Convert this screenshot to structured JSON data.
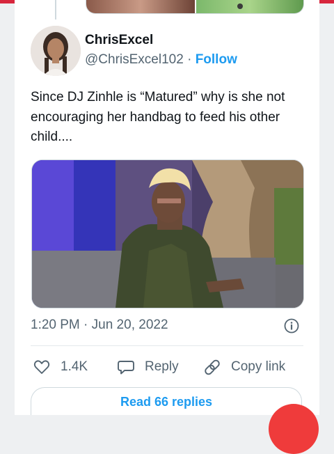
{
  "author": {
    "name": "ChrisExcel",
    "handle": "@ChrisExcel102",
    "separator": "·",
    "follow_label": "Follow"
  },
  "tweet": {
    "text": "Since DJ Zinhle is “Matured” why is she not encouraging her handbag to feed his other child....",
    "timestamp": "1:20 PM · Jun 20, 2022"
  },
  "actions": {
    "like_count": "1.4K",
    "reply_label": "Reply",
    "copy_link_label": "Copy link"
  },
  "replies_button": "Read 66 replies",
  "icons": {
    "avatar": "avatar",
    "info": "info-icon",
    "like": "heart-icon",
    "reply": "speech-bubble-icon",
    "copy": "link-icon"
  },
  "colors": {
    "accent": "#1d9bf0",
    "text": "#0f1419",
    "secondary": "#536471",
    "top_bar": "#d7263d"
  }
}
